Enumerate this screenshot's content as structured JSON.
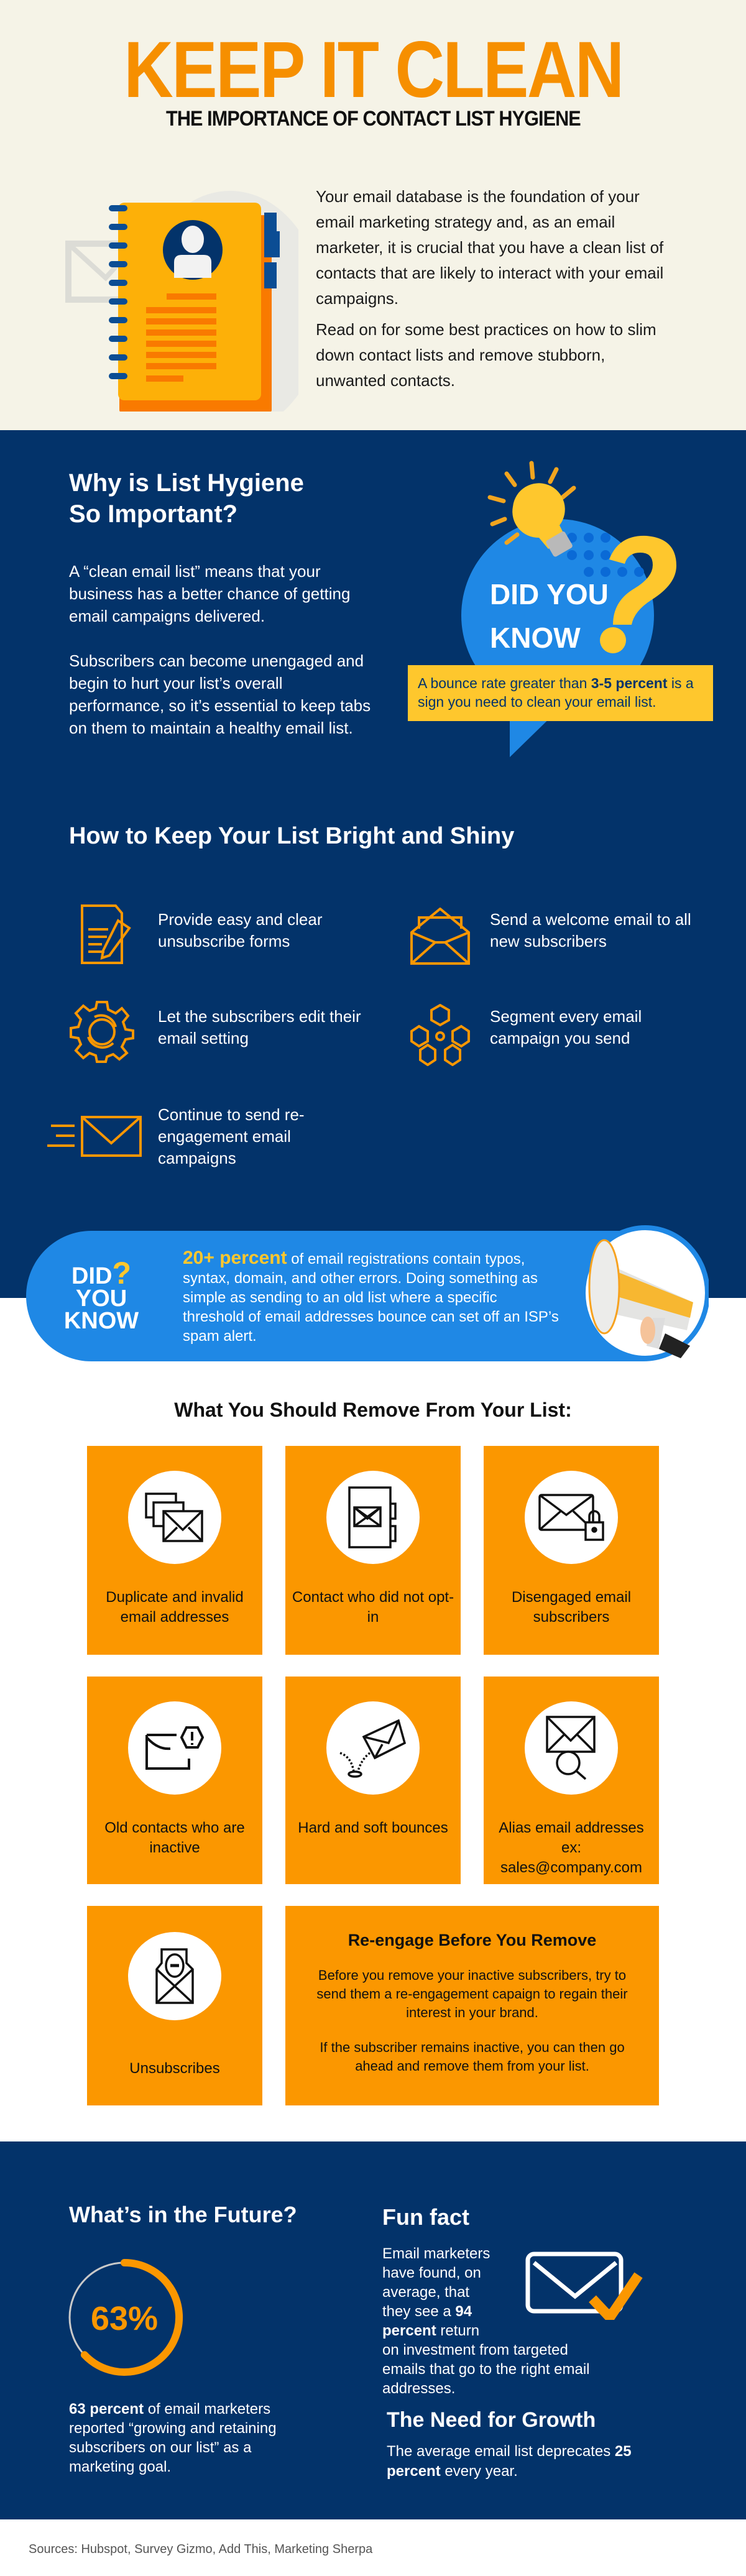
{
  "header": {
    "title": "KEEP IT CLEAN",
    "subtitle": "THE IMPORTANCE OF CONTACT LIST HYGIENE"
  },
  "intro": {
    "p1": "Your email database is the foundation of your email marketing strategy and, as an email marketer, it is crucial that you have a clean list of contacts that are likely to interact with your email campaigns.",
    "p2": "Read on for some best practices on how to slim down contact lists and remove stubborn, unwanted contacts."
  },
  "why": {
    "title_line1": "Why is List Hygiene",
    "title_line2": "So Important?",
    "p1": "A “clean email list” means that your business has a better chance of getting email campaigns delivered.",
    "p2": "Subscribers can become unengaged and begin to hurt your list’s overall performance, so it’s essential to keep tabs on them to maintain a healthy email list."
  },
  "did_you_know_1": {
    "line1": "DID YOU",
    "line2": "KNOW",
    "fact_pre": "A bounce rate greater than ",
    "fact_bold": "3-5 percent",
    "fact_post": " is a sign you need to clean your email list."
  },
  "tips": {
    "title": "How to Keep Your List Bright and Shiny",
    "items": [
      {
        "icon": "document-pencil-icon",
        "text": "Provide easy and clear unsubscribe forms"
      },
      {
        "icon": "open-envelope-icon",
        "text": "Send a welcome email to all new subscribers"
      },
      {
        "icon": "gear-icon",
        "text": "Let the subscribers edit their email setting"
      },
      {
        "icon": "hexagon-network-icon",
        "text": "Segment every email campaign you send"
      },
      {
        "icon": "fast-envelope-icon",
        "text": "Continue to send re-engagement email campaigns"
      }
    ]
  },
  "did_you_know_2": {
    "line1": "DID",
    "line2": "YOU",
    "line3": "KNOW",
    "q": "?",
    "bold": "20+ percent",
    "text": " of email registrations contain typos, syntax, domain, and other errors. Doing something as simple as sending to an old list where a specific threshold of email addresses bounce can set off an ISP’s spam alert."
  },
  "remove": {
    "title": "What You Should Remove From Your List:",
    "cards": [
      {
        "icon": "multiple-envelopes-icon",
        "label": "Duplicate and invalid email addresses"
      },
      {
        "icon": "address-book-envelope-icon",
        "label": "Contact who did not opt-in"
      },
      {
        "icon": "envelope-lock-icon",
        "label": "Disengaged email subscribers"
      },
      {
        "icon": "envelope-alert-icon",
        "label": "Old contacts who are inactive"
      },
      {
        "icon": "bouncing-envelope-icon",
        "label": "Hard and soft bounces"
      },
      {
        "icon": "envelope-search-icon",
        "label": "Alias email addresses ex: sales@company.com"
      },
      {
        "icon": "envelope-minus-icon",
        "label": "Unsubscribes"
      }
    ],
    "reengage": {
      "title": "Re-engage Before You Remove",
      "p1": "Before you remove your inactive subscribers, try to send them a re-engagement capaign to regain their interest in your brand.",
      "p2": "If the subscriber remains inactive, you can then go ahead and remove them from your list."
    }
  },
  "future": {
    "title": "What’s in the Future?",
    "percent_label": "63%",
    "percent_value": 63,
    "caption_bold": "63 percent",
    "caption": " of email marketers reported “growing and retaining subscribers on our list” as a marketing goal."
  },
  "fun_fact": {
    "title": "Fun fact",
    "pre": "Email marketers have found, on average, that they see a ",
    "bold": "94 percent",
    "post": " return on investment from targeted emails that go to the right email addresses."
  },
  "growth": {
    "title": "The Need for Growth",
    "pre": "The average email list deprecates ",
    "bold": "25 percent",
    "post": " every year."
  },
  "sources": "Sources: Hubspot, Survey Gizmo, Add This, Marketing Sherpa",
  "colors": {
    "orange": "#f68f00",
    "card_orange": "#fb9700",
    "navy": "#03336a",
    "blue": "#1f88e5",
    "yellow": "#fec72d",
    "cream": "#f5f3e7"
  }
}
